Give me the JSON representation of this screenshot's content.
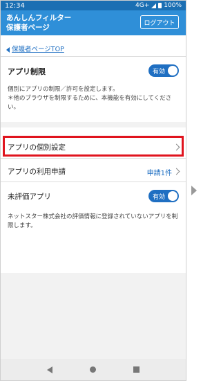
{
  "status_bar": {
    "time": "12:34",
    "network": "4G+",
    "battery": "100%"
  },
  "header": {
    "title_line1": "あんしんフィルター",
    "title_line2": "保護者ページ",
    "logout_label": "ログアウト"
  },
  "breadcrumb": {
    "label": "保護者ページTOP"
  },
  "app_restriction": {
    "title": "アプリ制限",
    "toggle_label": "有効",
    "description": "個別にアプリの制限／許可を設定します。\n＊他のブラウザを制限するために、本機能を有効にしてください。"
  },
  "menu": {
    "individual_settings": "アプリの個別設定",
    "usage_request": "アプリの利用申請",
    "request_count": "申請1件",
    "unrated_apps": "未評価アプリ",
    "unrated_toggle_label": "有効",
    "unrated_description": "ネットスター株式会社の評価情報に登録されていないアプリを制限します。"
  },
  "colors": {
    "accent": "#2f8fd8",
    "toggle_on": "#1f6fc2",
    "highlight": "#e0141e"
  }
}
